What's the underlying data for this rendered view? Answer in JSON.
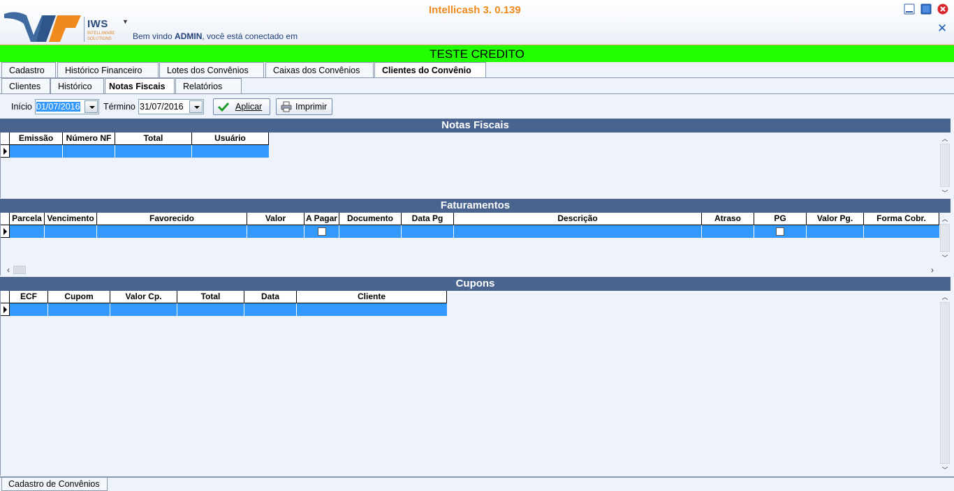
{
  "header": {
    "app_title": "Intellicash 3. 0.139",
    "logo_text": "IWS",
    "logo_sub1": "INTELLIWARE",
    "logo_sub2": "SOLUTIONS",
    "welcome_prefix": "Bem vindo ",
    "welcome_user": "ADMIN",
    "welcome_suffix": ", você está conectado em",
    "company_name": "TESTE CREDITO"
  },
  "colors": {
    "accent_green": "#22ff00",
    "section_header": "#4a6490",
    "row_selected": "#3399ff",
    "title_orange": "#f08a1c"
  },
  "main_tabs": [
    {
      "label": "Cadastro",
      "active": false
    },
    {
      "label": "Histórico Financeiro",
      "active": false
    },
    {
      "label": "Lotes dos Convênios",
      "active": false
    },
    {
      "label": "Caixas dos Convênios",
      "active": false
    },
    {
      "label": "Clientes do Convênio",
      "active": true
    }
  ],
  "sub_tabs": [
    {
      "label": "Clientes",
      "active": false
    },
    {
      "label": "Histórico",
      "active": false
    },
    {
      "label": "Notas Fiscais",
      "active": true
    },
    {
      "label": "Relatórios",
      "active": false
    }
  ],
  "filter": {
    "inicio_label": "Início",
    "inicio_value": "01/07/2016",
    "termino_label": "Término",
    "termino_value": "31/07/2016",
    "apply_label": "Aplicar",
    "print_label": "Imprimir"
  },
  "notas_fiscais": {
    "title": "Notas Fiscais",
    "columns": [
      "Emissão",
      "Número NF",
      "Total",
      "Usuário"
    ]
  },
  "faturamentos": {
    "title": "Faturamentos",
    "columns": [
      "Parcela",
      "Vencimento",
      "Favorecido",
      "Valor",
      "A Pagar",
      "Documento",
      "Data Pg",
      "Descrição",
      "Atraso",
      "PG",
      "Valor Pg.",
      "Forma Cobr."
    ]
  },
  "cupons": {
    "title": "Cupons",
    "columns": [
      "ECF",
      "Cupom",
      "Valor Cp.",
      "Total",
      "Data",
      "Cliente"
    ]
  },
  "bottom_tab": {
    "label": "Cadastro de Convênios"
  }
}
